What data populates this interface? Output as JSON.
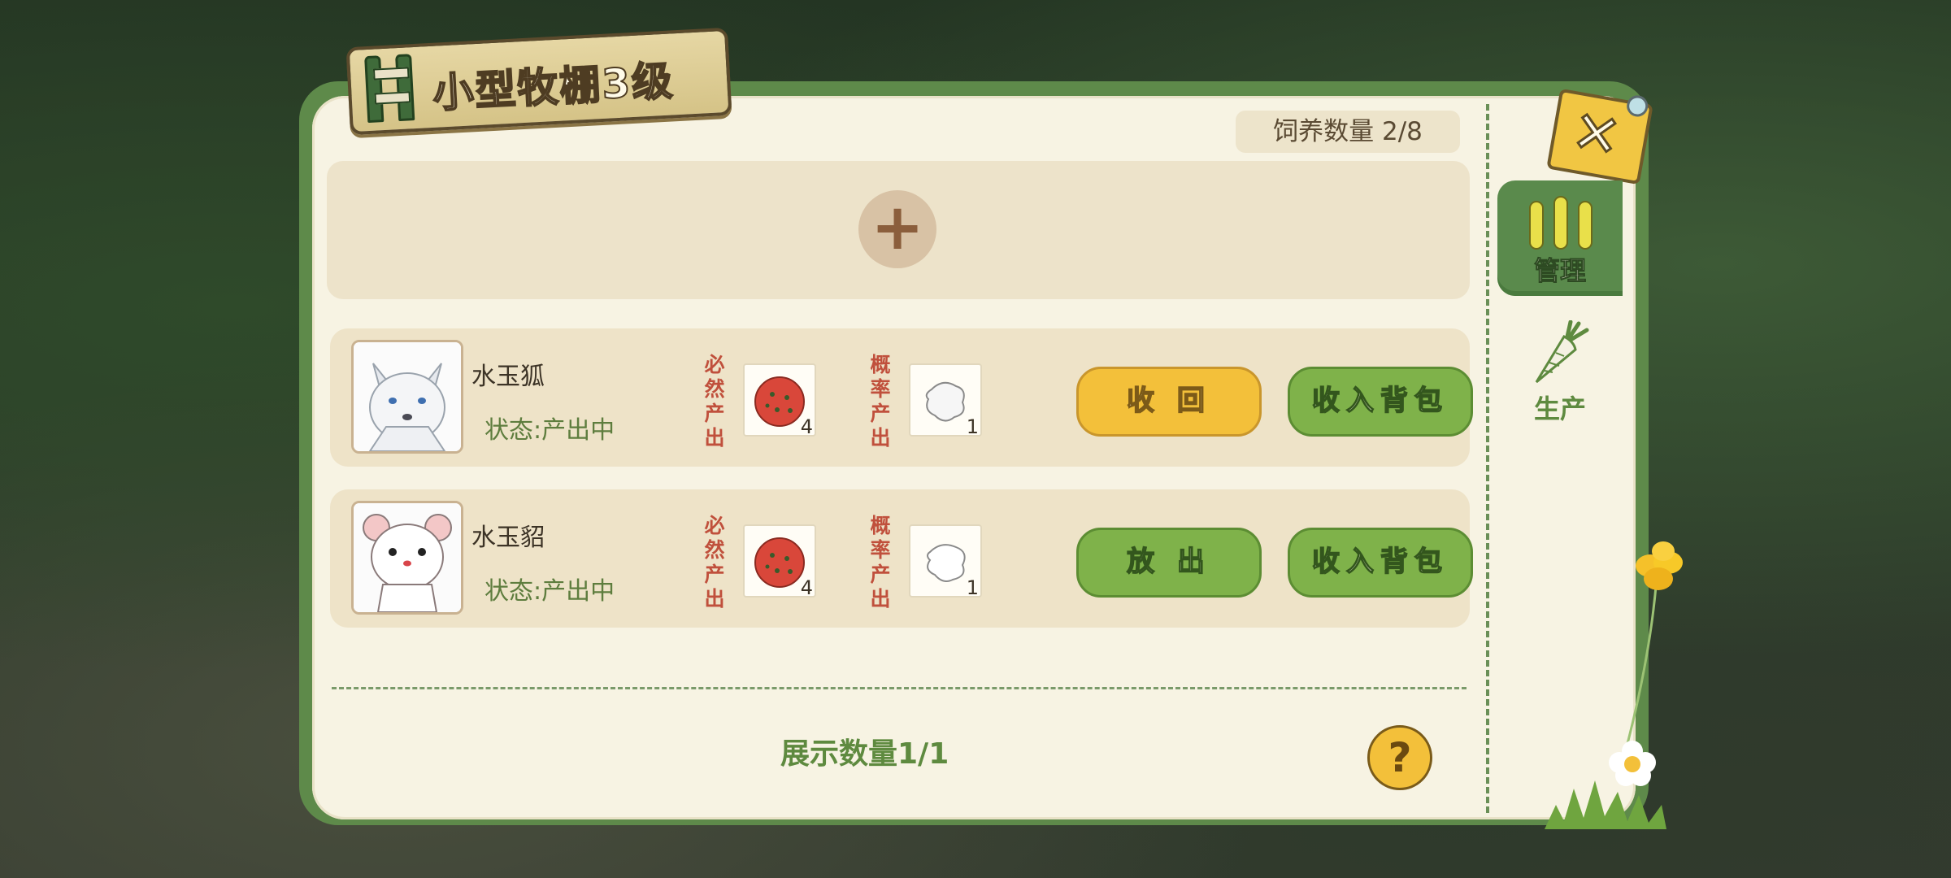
{
  "window": {
    "title": "小型牧棚3级",
    "capacity_label": "饲养数量 2/8"
  },
  "side_tabs": [
    {
      "label": "管理",
      "icon": "fence-icon",
      "active": true
    },
    {
      "label": "生产",
      "icon": "carrot-icon",
      "active": false
    }
  ],
  "add_slot": {
    "icon": "plus-icon",
    "symbol": "+"
  },
  "animals": [
    {
      "name": "水玉狐",
      "status": "状态:产出中",
      "portrait": "white-fox-portrait",
      "guaranteed_label": "必\n然\n产\n出",
      "guaranteed_item": {
        "icon": "red-meat-ball-icon",
        "qty": "4"
      },
      "chance_label": "概\n率\n产\n出",
      "chance_item": {
        "icon": "white-fur-icon",
        "qty": "1"
      },
      "action_button": "收 回",
      "action_color": "#f3c03a",
      "bag_button": "收入背包"
    },
    {
      "name": "水玉貂",
      "status": "状态:产出中",
      "portrait": "white-ferret-portrait",
      "guaranteed_label": "必\n然\n产\n出",
      "guaranteed_item": {
        "icon": "red-meat-ball-icon",
        "qty": "4"
      },
      "chance_label": "概\n率\n产\n出",
      "chance_item": {
        "icon": "white-fur-icon",
        "qty": "1"
      },
      "action_button": "放 出",
      "action_color": "#7fb24a",
      "bag_button": "收入背包"
    }
  ],
  "footer": {
    "display_count": "展示数量1/1",
    "help_symbol": "?"
  },
  "close": {
    "symbol": "✕",
    "icon": "close-icon"
  },
  "colors": {
    "panel_green": "#5e8a4a",
    "panel_bg": "#f7f3e3",
    "button_yellow": "#f3c03a",
    "button_green": "#7fb24a",
    "output_tag": "#c0503c"
  }
}
